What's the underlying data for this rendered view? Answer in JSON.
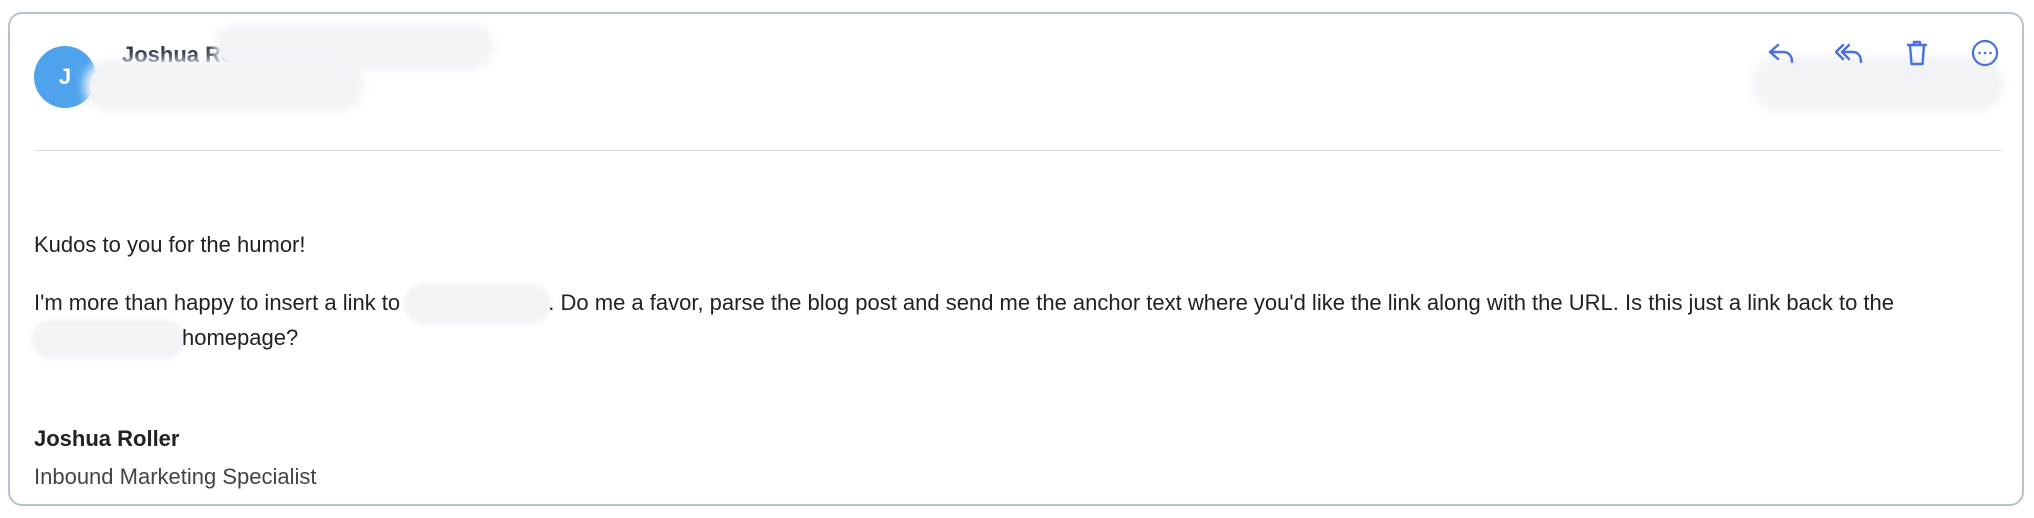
{
  "sender": {
    "avatar_letter": "J",
    "name": "Joshua Roller"
  },
  "toolbar": {
    "icons": [
      "reply-icon",
      "reply-all-icon",
      "trash-icon",
      "more-icon"
    ],
    "accent_color": "#4a6fe0"
  },
  "message": {
    "greeting": "Kudos to you for the humor!",
    "line1_part1": "I'm more than happy to insert a link to ",
    "line1_part2": ". Do me a favor, parse the blog post and send me the anchor text where you'd like the link along with the URL. Is this just a link back to the",
    "line1_part3": "homepage?"
  },
  "signature": {
    "name": "Joshua Roller",
    "title": "Inbound Marketing Specialist"
  },
  "colors": {
    "avatar": "#4ea3ec",
    "border": "#b7c2cc",
    "icon": "#4a6fe0"
  }
}
